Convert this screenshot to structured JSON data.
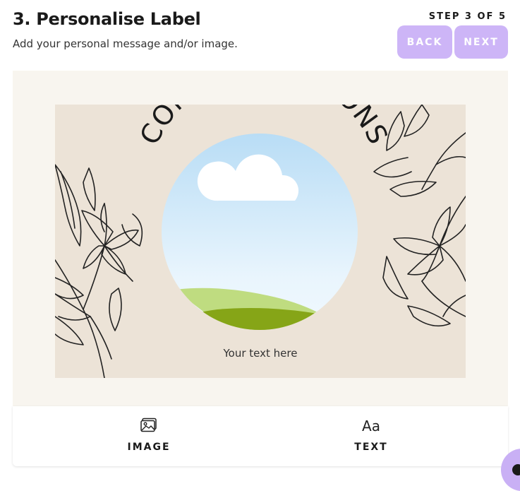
{
  "header": {
    "title": "3. Personalise Label",
    "subtitle": "Add your personal message and/or image.",
    "step": "STEP 3 OF 5",
    "back_label": "BACK",
    "next_label": "NEXT"
  },
  "label": {
    "heading": "CONGRATULATIONS",
    "text": "Your text here"
  },
  "toolbar": {
    "image_label": "IMAGE",
    "text_label": "TEXT",
    "text_icon_glyph": "Aa",
    "image_icon": "image-icon",
    "text_icon": "text-icon"
  },
  "colors": {
    "accent": "#cdb5f7",
    "canvas_bg": "#ece3d7",
    "editor_bg": "#f8f5ef"
  }
}
